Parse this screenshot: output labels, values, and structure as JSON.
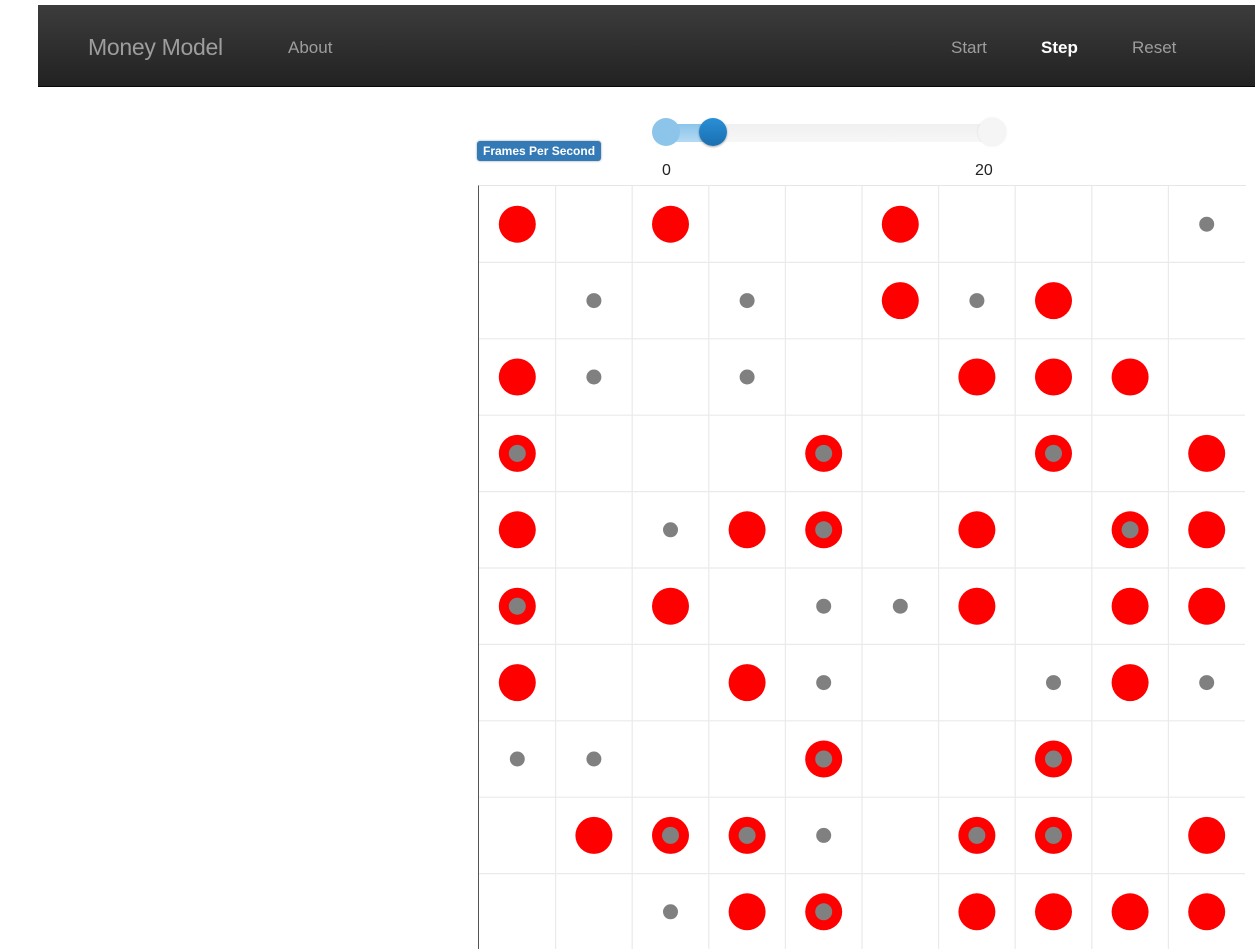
{
  "navbar": {
    "brand": "Money Model",
    "about": "About",
    "start": "Start",
    "step": "Step",
    "reset": "Reset"
  },
  "controls": {
    "fps_label": "Frames Per Second",
    "fps_min": "0",
    "fps_max": "20",
    "fps_value": 3,
    "fps_range": [
      0,
      20
    ]
  },
  "grid": {
    "columns": 10,
    "rows": 10,
    "legend_colors": {
      "agent_with_money": "#ff0000",
      "agent_without_money": "#808080"
    },
    "cells": [
      [
        "red",
        "",
        "red",
        "",
        "",
        "red",
        "",
        "",
        "",
        "gray"
      ],
      [
        "",
        "gray",
        "",
        "gray",
        "",
        "red",
        "gray",
        "red",
        "",
        ""
      ],
      [
        "red",
        "gray",
        "",
        "gray",
        "",
        "",
        "red",
        "red",
        "red",
        ""
      ],
      [
        "both",
        "",
        "",
        "",
        "both",
        "",
        "",
        "both",
        "",
        "red"
      ],
      [
        "red",
        "",
        "gray",
        "red",
        "both",
        "",
        "red",
        "",
        "both",
        "red"
      ],
      [
        "both",
        "",
        "red",
        "",
        "gray",
        "gray",
        "red",
        "",
        "red",
        "red"
      ],
      [
        "red",
        "",
        "",
        "red",
        "gray",
        "",
        "",
        "gray",
        "red",
        "gray"
      ],
      [
        "gray",
        "gray",
        "",
        "",
        "both",
        "",
        "",
        "both",
        "",
        ""
      ],
      [
        "",
        "red",
        "both",
        "both",
        "gray",
        "",
        "both",
        "both",
        "",
        "red"
      ],
      [
        "",
        "",
        "gray",
        "red",
        "both",
        "",
        "red",
        "red",
        "red",
        "red"
      ]
    ]
  }
}
